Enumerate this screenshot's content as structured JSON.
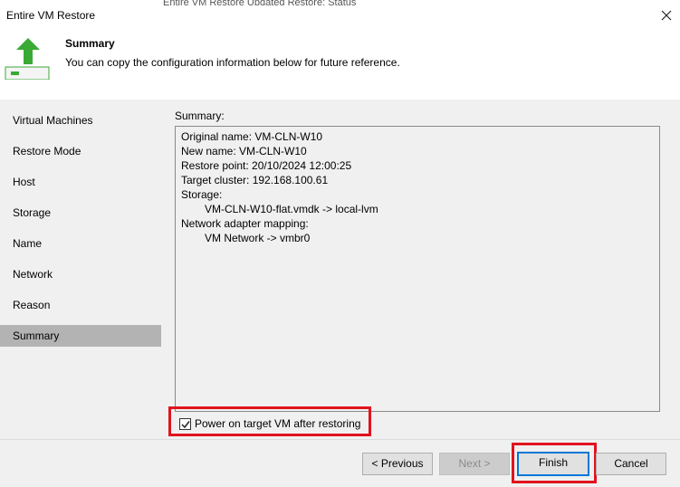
{
  "window": {
    "title": "Entire VM Restore",
    "background_strip": "  Entire VM   Restore          Updated     Restore: Status"
  },
  "header": {
    "title": "Summary",
    "description": "You can copy the configuration information below for future reference.",
    "icon": "green-up-arrow-vm-icon"
  },
  "sidebar": {
    "items": [
      {
        "label": "Virtual Machines"
      },
      {
        "label": "Restore Mode"
      },
      {
        "label": "Host"
      },
      {
        "label": "Storage"
      },
      {
        "label": "Name"
      },
      {
        "label": "Network"
      },
      {
        "label": "Reason"
      },
      {
        "label": "Summary"
      }
    ],
    "selected": "Summary"
  },
  "summary": {
    "label": "Summary:",
    "lines": [
      "Original name: VM-CLN-W10",
      "New name: VM-CLN-W10",
      "Restore point: 20/10/2024 12:00:25",
      "Target cluster: 192.168.100.61",
      "Storage:",
      "VM-CLN-W10-flat.vmdk -> local-lvm",
      "Network adapter mapping:",
      "VM Network -> vmbr0"
    ]
  },
  "options": {
    "power_on_label": "Power on target VM after restoring",
    "power_on_checked": true
  },
  "buttons": {
    "previous": "< Previous",
    "next": "Next >",
    "finish": "Finish",
    "cancel": "Cancel"
  },
  "colors": {
    "highlight": "#e0131e",
    "selected_nav": "#b3b3b3",
    "focus_border": "#0078d7",
    "icon_green": "#3aaa35"
  }
}
